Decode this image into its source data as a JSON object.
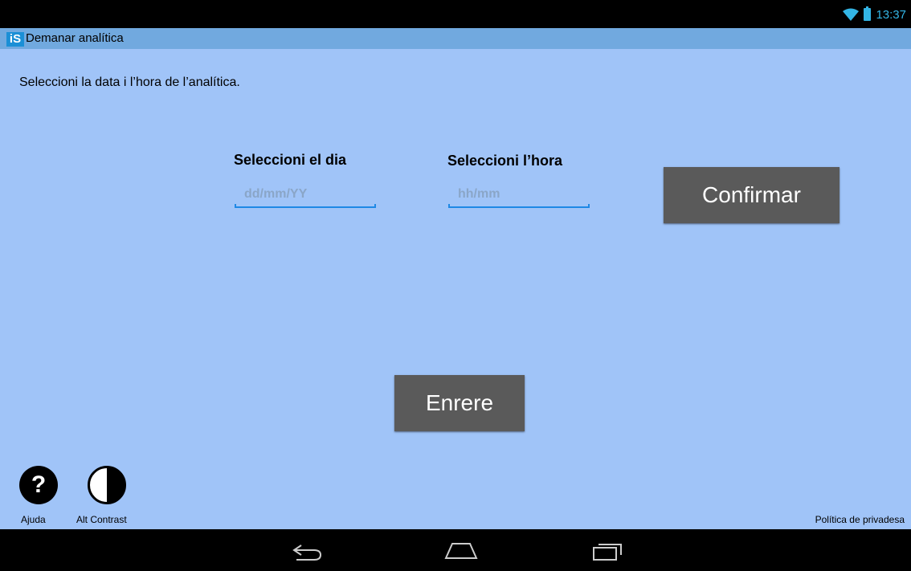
{
  "status_bar": {
    "time": "13:37",
    "icons": [
      "wifi-icon",
      "battery-icon"
    ]
  },
  "app": {
    "title": "Demanar analítica",
    "logo_text": "iS"
  },
  "main": {
    "instruction": "Seleccioni la data i l’hora de l’analítica.",
    "date_field": {
      "label": "Seleccioni el dia",
      "placeholder": "dd/mm/YY",
      "value": ""
    },
    "time_field": {
      "label": "Seleccioni l’hora",
      "placeholder": "hh/mm",
      "value": ""
    },
    "confirm_label": "Confirmar",
    "back_label": "Enrere"
  },
  "footer": {
    "help_label": "Ajuda",
    "help_glyph": "?",
    "contrast_label": "Alt Contrast",
    "privacy_label": "Política de privadesa"
  },
  "nav_bar": {
    "buttons": [
      "back-icon",
      "home-icon",
      "recents-icon"
    ]
  },
  "colors": {
    "background": "#a0c4f8",
    "action_bar": "#71a9df",
    "button": "#5a5a5a",
    "accent": "#33b5e5",
    "field_underline": "#1e88e5"
  }
}
